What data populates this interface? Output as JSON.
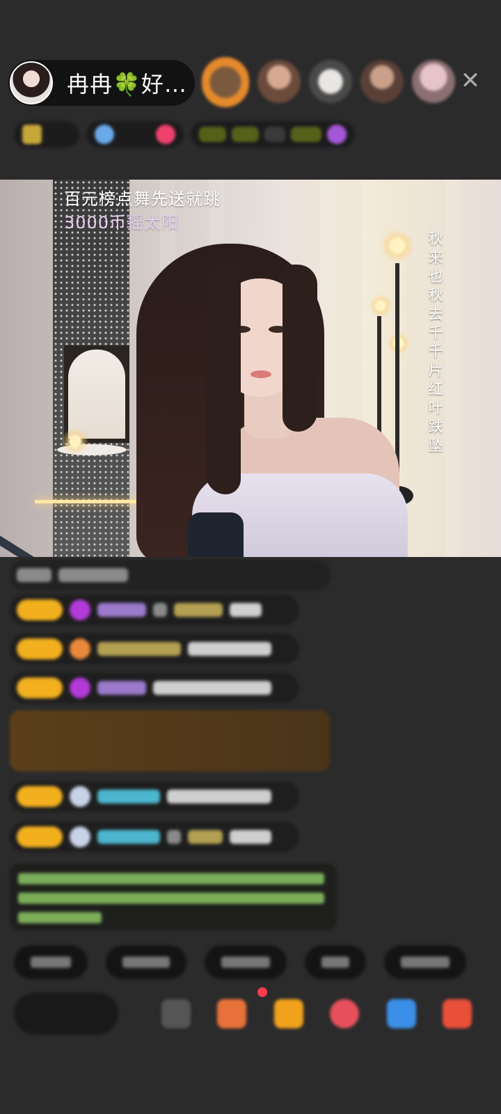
{
  "host": {
    "name": "冉冉🍀好…"
  },
  "header": {
    "close_icon": "close-icon"
  },
  "stream": {
    "overlay_line1": "百元榜点舞先送就跳",
    "overlay_line2": "3000币摇太阳",
    "vertical_caption": "秋来也秋去千千片红叶跌坠"
  },
  "colors": {
    "background": "#2b2b2c",
    "badge_gold": "#f2b01e",
    "accent_purple": "#b23bd8",
    "highlight_brown": "#5b3f1a",
    "notice_green": "#7cae5a"
  }
}
